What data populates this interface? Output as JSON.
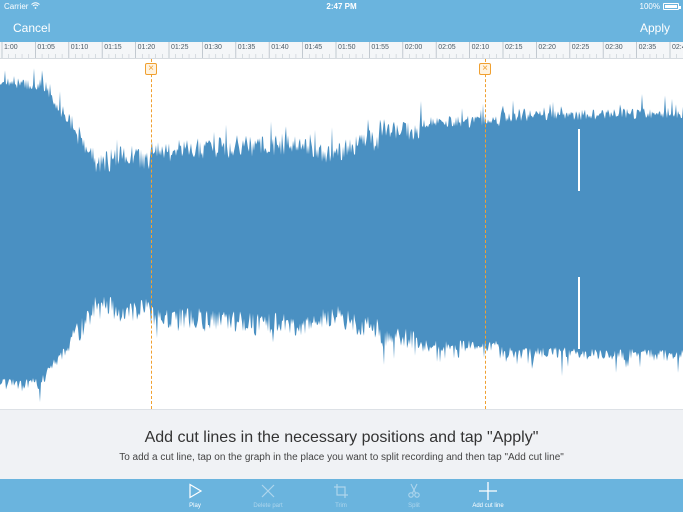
{
  "status_bar": {
    "carrier": "Carrier",
    "time": "2:47 PM",
    "battery": "100%"
  },
  "nav": {
    "cancel_label": "Cancel",
    "apply_label": "Apply"
  },
  "ruler": {
    "labels": [
      "1:00",
      "01:05",
      "01:10",
      "01:15",
      "01:20",
      "01:25",
      "01:30",
      "01:35",
      "01:40",
      "01:45",
      "01:50",
      "01:55",
      "02:00",
      "02:05",
      "02:10",
      "02:15",
      "02:20",
      "02:25",
      "02:30",
      "02:35",
      "02:40"
    ]
  },
  "waveform": {
    "color": "#4a90c2"
  },
  "cut_lines": [
    {
      "time": "01:24"
    },
    {
      "time": "02:14"
    }
  ],
  "info": {
    "title": "Add cut lines in the necessary positions and tap \"Apply\"",
    "subtitle": "To add a cut line, tap on the graph in the place you want to split recording and then tap \"Add cut line\""
  },
  "toolbar": {
    "items": [
      {
        "label": "Play",
        "icon": "play-icon",
        "enabled": true
      },
      {
        "label": "Delete part",
        "icon": "delete-icon",
        "enabled": false
      },
      {
        "label": "Trim",
        "icon": "crop-icon",
        "enabled": false
      },
      {
        "label": "Split",
        "icon": "scissors-icon",
        "enabled": false
      },
      {
        "label": "Add cut line",
        "icon": "plus-icon",
        "enabled": true
      }
    ]
  },
  "colors": {
    "accent": "#6ab4de",
    "cut": "#f0a030"
  }
}
